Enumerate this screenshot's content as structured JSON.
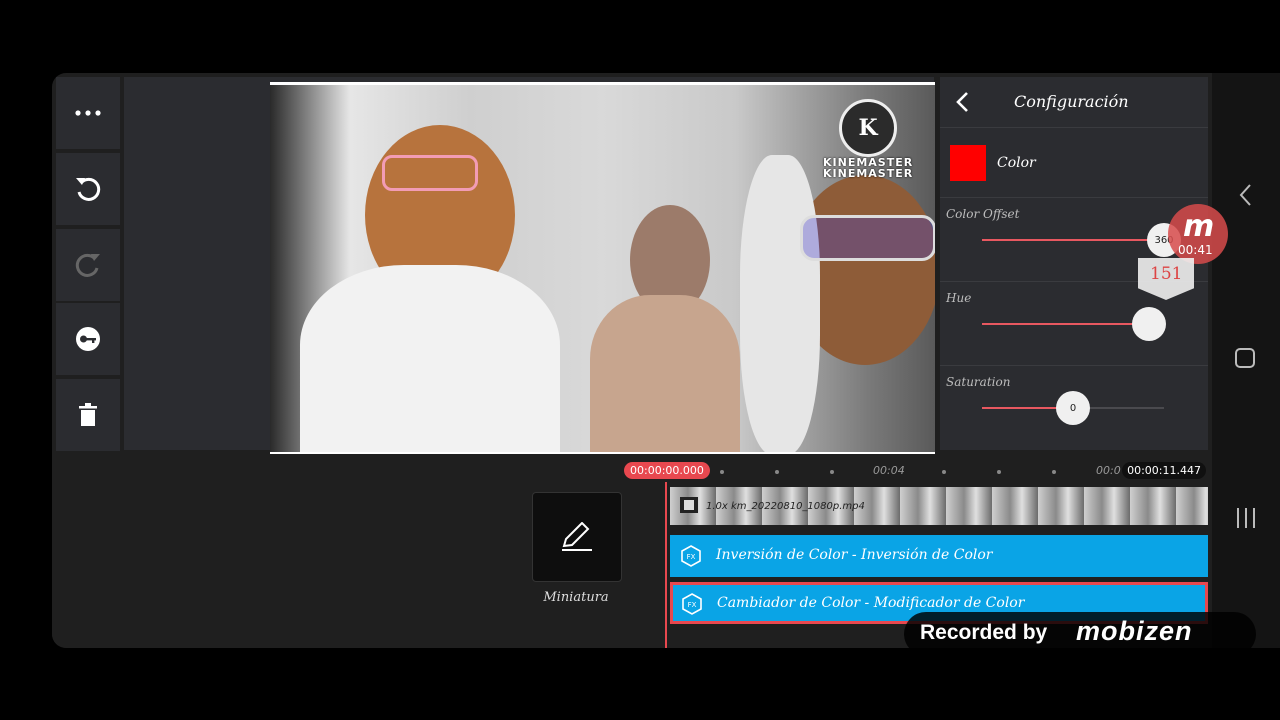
{
  "app": {
    "name": "KineMaster"
  },
  "toolbar": {
    "items": [
      {
        "icon": "more-icon"
      },
      {
        "icon": "undo-icon"
      },
      {
        "icon": "redo-icon"
      },
      {
        "icon": "keyframe-icon"
      },
      {
        "icon": "delete-icon"
      },
      {
        "icon": "expand-timeline-icon"
      },
      {
        "icon": "pin-icon"
      }
    ]
  },
  "preview": {
    "watermark": "KINEMASTER"
  },
  "panel": {
    "title": "Configuración",
    "color_label": "Color",
    "color_value": "#ff0000",
    "sliders": [
      {
        "label": "Color Offset",
        "value": "360",
        "level": 1.0
      },
      {
        "label": "Hue",
        "value": "",
        "level": 0.92
      },
      {
        "label": "Saturation",
        "value": "0",
        "level": 0.5
      }
    ]
  },
  "overlay": {
    "recorder_icon": "m",
    "recorder_time": "00:41",
    "handwritten_value": "151",
    "recorded_by": "Recorded by",
    "recorder_brand": "mobizen"
  },
  "timeline": {
    "current_time": "00:00:00.000",
    "tick_1": "00:04",
    "tick_2": "00:0",
    "end_time": "00:00:11.447",
    "thumbnail_label": "Miniatura",
    "video_clip_name": "1.0x km_20220810_1080p.mp4",
    "layers": [
      {
        "label": "Inversión de Color - Inversión de Color",
        "selected": false
      },
      {
        "label": "Cambiador de Color - Modificador de Color",
        "selected": true
      }
    ]
  },
  "colors": {
    "accent": "#e8484f",
    "layer": "#0aa4e6",
    "panel": "#2b2c30"
  }
}
